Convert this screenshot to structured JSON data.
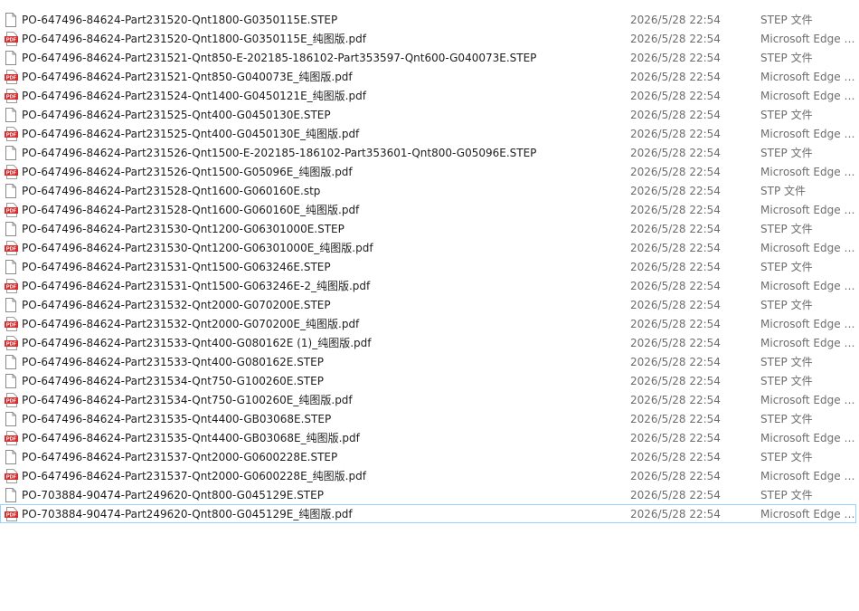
{
  "icons": {
    "step": "blank-document-icon",
    "pdf": "pdf-document-icon"
  },
  "colors": {
    "pdf_red": "#d32f2f",
    "focus_border": "#99d1ff"
  },
  "files": [
    {
      "name": "PO-647496-84624-Part231520-Qnt1800-G0350115E.STEP",
      "modified": "2026/5/28 22:54",
      "type": "STEP 文件",
      "icon": "step"
    },
    {
      "name": "PO-647496-84624-Part231520-Qnt1800-G0350115E_纯图版.pdf",
      "modified": "2026/5/28 22:54",
      "type": "Microsoft Edge …",
      "icon": "pdf"
    },
    {
      "name": "PO-647496-84624-Part231521-Qnt850-E-202185-186102-Part353597-Qnt600-G040073E.STEP",
      "modified": "2026/5/28 22:54",
      "type": "STEP 文件",
      "icon": "step"
    },
    {
      "name": "PO-647496-84624-Part231521-Qnt850-G040073E_纯图版.pdf",
      "modified": "2026/5/28 22:54",
      "type": "Microsoft Edge …",
      "icon": "pdf"
    },
    {
      "name": "PO-647496-84624-Part231524-Qnt1400-G0450121E_纯图版.pdf",
      "modified": "2026/5/28 22:54",
      "type": "Microsoft Edge …",
      "icon": "pdf"
    },
    {
      "name": "PO-647496-84624-Part231525-Qnt400-G0450130E.STEP",
      "modified": "2026/5/28 22:54",
      "type": "STEP 文件",
      "icon": "step"
    },
    {
      "name": "PO-647496-84624-Part231525-Qnt400-G0450130E_纯图版.pdf",
      "modified": "2026/5/28 22:54",
      "type": "Microsoft Edge …",
      "icon": "pdf"
    },
    {
      "name": "PO-647496-84624-Part231526-Qnt1500-E-202185-186102-Part353601-Qnt800-G05096E.STEP",
      "modified": "2026/5/28 22:54",
      "type": "STEP 文件",
      "icon": "step"
    },
    {
      "name": "PO-647496-84624-Part231526-Qnt1500-G05096E_纯图版.pdf",
      "modified": "2026/5/28 22:54",
      "type": "Microsoft Edge …",
      "icon": "pdf"
    },
    {
      "name": "PO-647496-84624-Part231528-Qnt1600-G060160E.stp",
      "modified": "2026/5/28 22:54",
      "type": "STP 文件",
      "icon": "step"
    },
    {
      "name": "PO-647496-84624-Part231528-Qnt1600-G060160E_纯图版.pdf",
      "modified": "2026/5/28 22:54",
      "type": "Microsoft Edge …",
      "icon": "pdf"
    },
    {
      "name": "PO-647496-84624-Part231530-Qnt1200-G06301000E.STEP",
      "modified": "2026/5/28 22:54",
      "type": "STEP 文件",
      "icon": "step"
    },
    {
      "name": "PO-647496-84624-Part231530-Qnt1200-G06301000E_纯图版.pdf",
      "modified": "2026/5/28 22:54",
      "type": "Microsoft Edge …",
      "icon": "pdf"
    },
    {
      "name": "PO-647496-84624-Part231531-Qnt1500-G063246E.STEP",
      "modified": "2026/5/28 22:54",
      "type": "STEP 文件",
      "icon": "step"
    },
    {
      "name": "PO-647496-84624-Part231531-Qnt1500-G063246E-2_纯图版.pdf",
      "modified": "2026/5/28 22:54",
      "type": "Microsoft Edge …",
      "icon": "pdf"
    },
    {
      "name": "PO-647496-84624-Part231532-Qnt2000-G070200E.STEP",
      "modified": "2026/5/28 22:54",
      "type": "STEP 文件",
      "icon": "step"
    },
    {
      "name": "PO-647496-84624-Part231532-Qnt2000-G070200E_纯图版.pdf",
      "modified": "2026/5/28 22:54",
      "type": "Microsoft Edge …",
      "icon": "pdf"
    },
    {
      "name": "PO-647496-84624-Part231533-Qnt400-G080162E (1)_纯图版.pdf",
      "modified": "2026/5/28 22:54",
      "type": "Microsoft Edge …",
      "icon": "pdf"
    },
    {
      "name": "PO-647496-84624-Part231533-Qnt400-G080162E.STEP",
      "modified": "2026/5/28 22:54",
      "type": "STEP 文件",
      "icon": "step"
    },
    {
      "name": "PO-647496-84624-Part231534-Qnt750-G100260E.STEP",
      "modified": "2026/5/28 22:54",
      "type": "STEP 文件",
      "icon": "step"
    },
    {
      "name": "PO-647496-84624-Part231534-Qnt750-G100260E_纯图版.pdf",
      "modified": "2026/5/28 22:54",
      "type": "Microsoft Edge …",
      "icon": "pdf"
    },
    {
      "name": "PO-647496-84624-Part231535-Qnt4400-GB03068E.STEP",
      "modified": "2026/5/28 22:54",
      "type": "STEP 文件",
      "icon": "step"
    },
    {
      "name": "PO-647496-84624-Part231535-Qnt4400-GB03068E_纯图版.pdf",
      "modified": "2026/5/28 22:54",
      "type": "Microsoft Edge …",
      "icon": "pdf"
    },
    {
      "name": "PO-647496-84624-Part231537-Qnt2000-G0600228E.STEP",
      "modified": "2026/5/28 22:54",
      "type": "STEP 文件",
      "icon": "step"
    },
    {
      "name": "PO-647496-84624-Part231537-Qnt2000-G0600228E_纯图版.pdf",
      "modified": "2026/5/28 22:54",
      "type": "Microsoft Edge …",
      "icon": "pdf"
    },
    {
      "name": "PO-703884-90474-Part249620-Qnt800-G045129E.STEP",
      "modified": "2026/5/28 22:54",
      "type": "STEP 文件",
      "icon": "step"
    },
    {
      "name": "PO-703884-90474-Part249620-Qnt800-G045129E_纯图版.pdf",
      "modified": "2026/5/28 22:54",
      "type": "Microsoft Edge …",
      "icon": "pdf",
      "focused": true
    }
  ]
}
